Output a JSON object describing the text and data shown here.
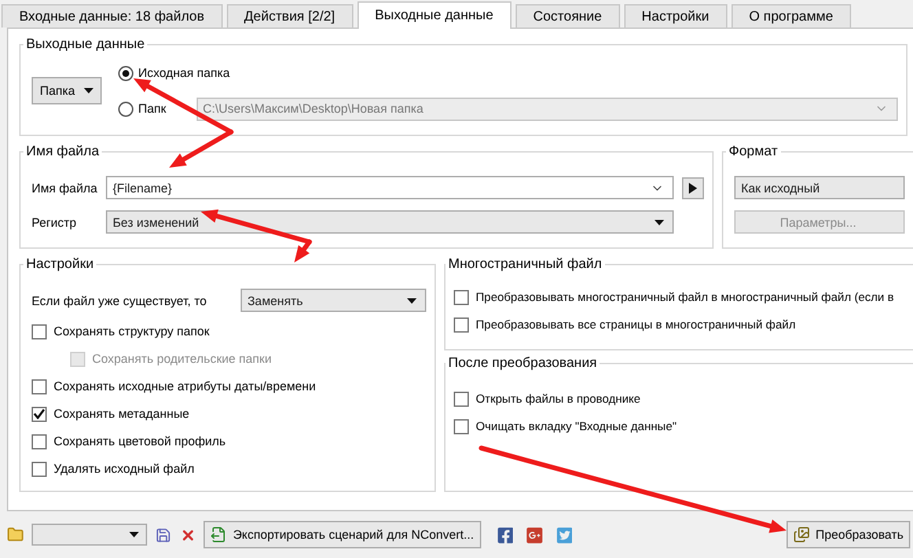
{
  "tabs": [
    {
      "label": "Входные данные: 18 файлов",
      "selected": false
    },
    {
      "label": "Действия [2/2]",
      "selected": false
    },
    {
      "label": "Выходные данные",
      "selected": true
    },
    {
      "label": "Состояние",
      "selected": false
    },
    {
      "label": "Настройки",
      "selected": false
    },
    {
      "label": "О программе",
      "selected": false
    }
  ],
  "output": {
    "title": "Выходные данные",
    "folder_menu": "Папка",
    "options": [
      {
        "label": "Исходная папка",
        "selected": true
      },
      {
        "label": "Папк",
        "selected": false
      }
    ],
    "path": "C:\\Users\\Максим\\Desktop\\Новая папка"
  },
  "filename": {
    "title": "Имя файла",
    "name_label": "Имя файла",
    "name_value": "{Filename}",
    "case_label": "Регистр",
    "case_value": "Без изменений"
  },
  "format": {
    "title": "Формат",
    "value": "Как исходный",
    "params_button": "Параметры...",
    "params_disabled": true
  },
  "settings": {
    "title": "Настройки",
    "exists_label": "Если файл уже существует, то",
    "exists_value": "Заменять",
    "checkboxes": [
      {
        "label": "Сохранять структуру папок",
        "checked": false,
        "disabled": false,
        "children": [
          {
            "label": "Сохранять родительские папки",
            "checked": false,
            "disabled": true
          }
        ]
      },
      {
        "label": "Сохранять исходные атрибуты даты/времени",
        "checked": false,
        "disabled": false
      },
      {
        "label": "Сохранять метаданные",
        "checked": true,
        "disabled": false
      },
      {
        "label": "Сохранять цветовой профиль",
        "checked": false,
        "disabled": false
      },
      {
        "label": "Удалять исходный файл",
        "checked": false,
        "disabled": false
      }
    ]
  },
  "multipage": {
    "title": "Многостраничный файл",
    "checkboxes": [
      {
        "label": "Преобразовывать многостраничный файл в многостраничный файл (если в",
        "checked": false,
        "disabled": false
      },
      {
        "label": "Преобразовывать все страницы в многостраничный файл",
        "checked": false,
        "disabled": false
      }
    ]
  },
  "after": {
    "title": "После преобразования",
    "checkboxes": [
      {
        "label": "Открыть файлы в проводнике",
        "checked": false,
        "disabled": false
      },
      {
        "label": "Очищать вкладку \"Входные данные\"",
        "checked": false,
        "disabled": false
      }
    ]
  },
  "toolbar": {
    "export_button": "Экспортировать сценарий для NConvert...",
    "convert_button": "Преобразовать"
  }
}
